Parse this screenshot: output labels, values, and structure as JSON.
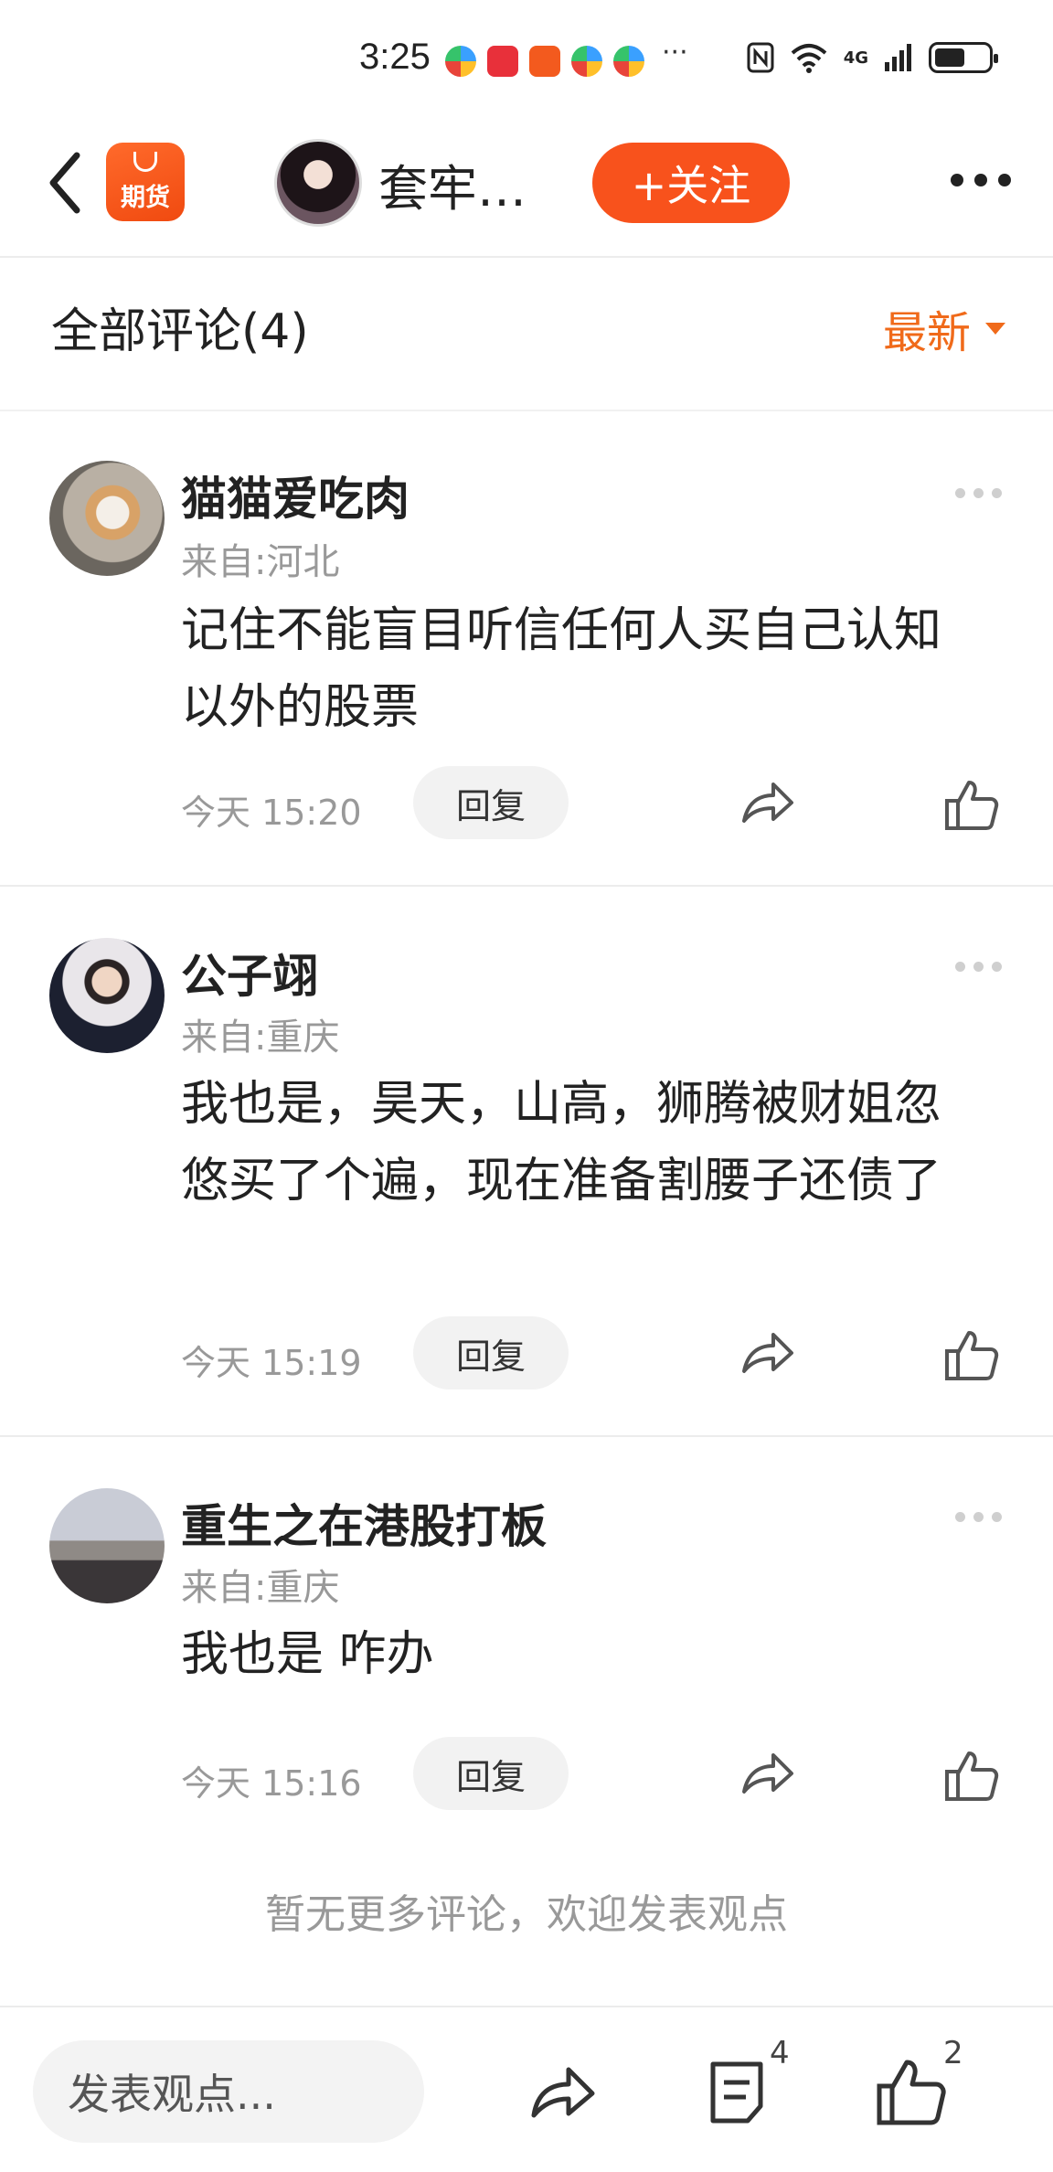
{
  "status_bar": {
    "time": "3:25",
    "more": "···",
    "network": "4G"
  },
  "nav": {
    "app_logo_text": "期货",
    "title": "套牢…",
    "follow_label": "+关注"
  },
  "comments_header": {
    "title": "全部评论(4)",
    "sort_label": "最新"
  },
  "comments": [
    {
      "name": "猫猫爱吃肉",
      "location": "来自:河北",
      "text": "记住不能盲目听信任何人买自己认知以外的股票",
      "time": "今天 15:20",
      "reply_label": "回复"
    },
    {
      "name": "公子翊",
      "location": "来自:重庆",
      "text": "我也是，昊天，山高，狮腾被财姐忽悠买了个遍，现在准备割腰子还债了",
      "time": "今天 15:19",
      "reply_label": "回复"
    },
    {
      "name": "重生之在港股打板",
      "location": "来自:重庆",
      "text": "我也是 咋办",
      "time": "今天 15:16",
      "reply_label": "回复"
    }
  ],
  "footer_note": "暂无更多评论，欢迎发表观点",
  "bottom_bar": {
    "input_placeholder": "发表观点...",
    "comment_count": "4",
    "like_count": "2"
  },
  "colors": {
    "accent": "#f8521c",
    "sort": "#f06a1a",
    "muted": "#999999"
  }
}
